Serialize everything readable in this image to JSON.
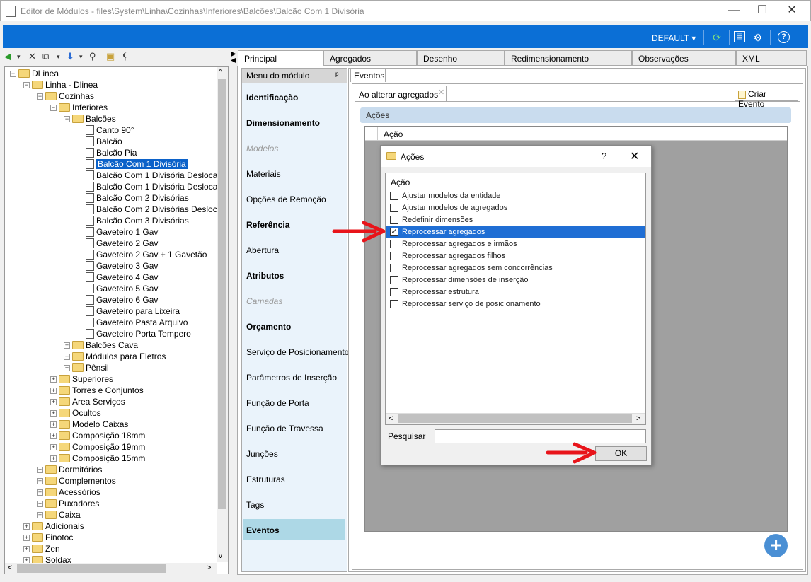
{
  "window": {
    "title": "Editor de Módulos - files\\System\\Linha\\Cozinhas\\Inferiores\\Balcões\\Balcão Com 1 Divisória",
    "minimize": "—",
    "maximize": "☐",
    "close": "✕"
  },
  "ribbon": {
    "profile": "DEFAULT ▾",
    "help": "?"
  },
  "tree": {
    "nodes": [
      {
        "label": "DLinea",
        "pm": "−"
      },
      {
        "label": "Linha - Dlinea",
        "pm": "−"
      },
      {
        "label": "Cozinhas",
        "pm": "−"
      },
      {
        "label": "Inferiores",
        "pm": "−"
      },
      {
        "label": "Balcões",
        "pm": "−"
      },
      {
        "label": "Canto 90°"
      },
      {
        "label": "Balcão"
      },
      {
        "label": "Balcão Pia"
      },
      {
        "label": "Balcão Com 1 Divisória"
      },
      {
        "label": "Balcão Com 1 Divisória Desloca"
      },
      {
        "label": "Balcão Com 1 Divisória Desloca"
      },
      {
        "label": "Balcão Com 2 Divisórias"
      },
      {
        "label": "Balcão Com 2 Divisórias Desloc"
      },
      {
        "label": "Balcão Com 3 Divisórias"
      },
      {
        "label": "Gaveteiro 1 Gav"
      },
      {
        "label": "Gaveteiro 2 Gav"
      },
      {
        "label": "Gaveteiro 2 Gav + 1 Gavetão"
      },
      {
        "label": "Gaveteiro 3 Gav"
      },
      {
        "label": "Gaveteiro 4 Gav"
      },
      {
        "label": "Gaveteiro 5 Gav"
      },
      {
        "label": "Gaveteiro 6 Gav"
      },
      {
        "label": "Gaveteiro para Lixeira"
      },
      {
        "label": "Gaveteiro Pasta Arquivo"
      },
      {
        "label": "Gaveteiro Porta Tempero"
      },
      {
        "label": "Balcões Cava",
        "pm": "+"
      },
      {
        "label": "Módulos para Eletros",
        "pm": "+"
      },
      {
        "label": "Pênsil",
        "pm": "+"
      },
      {
        "label": "Superiores",
        "pm": "+"
      },
      {
        "label": "Torres e Conjuntos",
        "pm": "+"
      },
      {
        "label": "Area Serviços",
        "pm": "+"
      },
      {
        "label": "Ocultos",
        "pm": "+"
      },
      {
        "label": "Modelo Caixas",
        "pm": "+"
      },
      {
        "label": "Composição 18mm",
        "pm": "+"
      },
      {
        "label": "Composição 19mm",
        "pm": "+"
      },
      {
        "label": "Composição 15mm",
        "pm": "+"
      },
      {
        "label": "Dormitórios",
        "pm": "+"
      },
      {
        "label": "Complementos",
        "pm": "+"
      },
      {
        "label": "Acessórios",
        "pm": "+"
      },
      {
        "label": "Puxadores",
        "pm": "+"
      },
      {
        "label": "Caixa",
        "pm": "+"
      },
      {
        "label": "Adicionais",
        "pm": "+"
      },
      {
        "label": "Finotoc",
        "pm": "+"
      },
      {
        "label": "Zen",
        "pm": "+"
      },
      {
        "label": "Soldax",
        "pm": "+"
      }
    ],
    "selected": "Balcão Com 1 Divisória",
    "scroll_left": "<",
    "scroll_right": ">",
    "scroll_up": "^",
    "scroll_down": "v"
  },
  "tabs": [
    "Principal",
    "Agregados",
    "Desenho",
    "Redimensionamento",
    "Observações",
    "XML"
  ],
  "active_tab": "Principal",
  "module_menu": {
    "header": "Menu do módulo",
    "pin": "ᵖ",
    "items": [
      {
        "label": "Identificação",
        "style": "bold"
      },
      {
        "label": "Dimensionamento",
        "style": "bold"
      },
      {
        "label": "Modelos",
        "style": "ital"
      },
      {
        "label": "Materiais",
        "style": ""
      },
      {
        "label": "Opções de Remoção",
        "style": ""
      },
      {
        "label": "Referência",
        "style": "bold"
      },
      {
        "label": "Abertura",
        "style": ""
      },
      {
        "label": "Atributos",
        "style": "bold"
      },
      {
        "label": "Camadas",
        "style": "ital"
      },
      {
        "label": "Orçamento",
        "style": "bold"
      },
      {
        "label": "Serviço de Posicionamento",
        "style": ""
      },
      {
        "label": "Parâmetros de Inserção",
        "style": ""
      },
      {
        "label": "Função de Porta",
        "style": ""
      },
      {
        "label": "Função de Travessa",
        "style": ""
      },
      {
        "label": "Junções",
        "style": ""
      },
      {
        "label": "Estruturas",
        "style": ""
      },
      {
        "label": "Tags",
        "style": ""
      },
      {
        "label": "Eventos",
        "style": "bold"
      }
    ]
  },
  "events": {
    "tab_label": "Eventos",
    "subtab_label": "Ao alterar agregados",
    "subtab_close": "✕",
    "create_button": "Criar Evento",
    "actions_bar": "Ações",
    "grid_column": "Ação",
    "add_button": "+"
  },
  "dialog": {
    "title": "Ações",
    "help": "?",
    "close": "✕",
    "list_header": "Ação",
    "items": [
      {
        "label": "Ajustar modelos da entidade",
        "checked": false
      },
      {
        "label": "Ajustar modelos de agregados",
        "checked": false
      },
      {
        "label": "Redefinir dimensões",
        "checked": false
      },
      {
        "label": "Reprocessar agregados",
        "checked": true
      },
      {
        "label": "Reprocessar agregados e irmãos",
        "checked": false
      },
      {
        "label": "Reprocessar agregados filhos",
        "checked": false
      },
      {
        "label": "Reprocessar agregados sem concorrências",
        "checked": false
      },
      {
        "label": "Reprocessar dimensões de inserção",
        "checked": false
      },
      {
        "label": "Reprocessar estrutura",
        "checked": false
      },
      {
        "label": "Reprocessar serviço de posicionamento",
        "checked": false
      }
    ],
    "scroll_left": "<",
    "scroll_right": ">",
    "search_label": "Pesquisar",
    "search_value": "",
    "ok_label": "OK"
  },
  "colors": {
    "ribbon": "#0b6fd6",
    "selection": "#1f6ed4",
    "annotation_arrow": "#e8141a"
  }
}
